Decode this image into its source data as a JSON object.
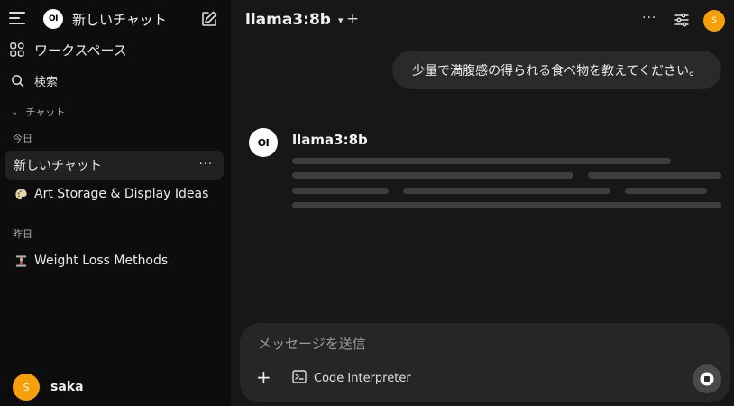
{
  "sidebar": {
    "new_chat_label": "新しいチャット",
    "logo_text": "OI",
    "workspace_label": "ワークスペース",
    "search_label": "検索",
    "chats_section_label": "チャット",
    "today_label": "今日",
    "yesterday_label": "昨日",
    "chats_today": [
      {
        "title": "新しいチャット",
        "active": true
      },
      {
        "title": "Art Storage & Display Ideas",
        "emoji_icon": "palette-icon"
      }
    ],
    "chats_yesterday": [
      {
        "title": "Weight Loss Methods",
        "emoji_icon": "dumbbell-icon"
      }
    ],
    "more_label": "···",
    "user": {
      "initial": "S",
      "name": "saka"
    }
  },
  "header": {
    "model_name": "llama3:8b",
    "add_label": "+",
    "more_label": "···",
    "avatar_initial": "S"
  },
  "messages": {
    "user_message": "少量で満腹感の得られる食べ物を教えてください。",
    "assistant_avatar_text": "OI",
    "assistant_name": "llama3:8b"
  },
  "composer": {
    "placeholder": "メッセージを送信",
    "add_label": "+",
    "code_interpreter_label": "Code Interpreter"
  },
  "colors": {
    "accent_avatar": "#f5a00a",
    "sidebar_bg": "#0d0d0d",
    "main_bg": "#171717",
    "bubble_bg": "#2a2a2a",
    "composer_bg": "#262626"
  }
}
